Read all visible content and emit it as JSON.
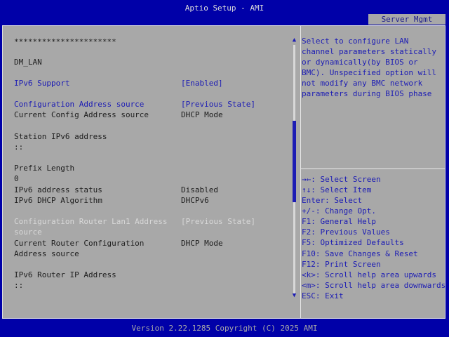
{
  "header": {
    "title": "Aptio Setup - AMI",
    "tab": "Server Mgmt"
  },
  "left": {
    "separator": "**********************",
    "section": "DM_LAN",
    "ipv6_support": {
      "label": "IPv6 Support",
      "value": "[Enabled]"
    },
    "config_addr_source": {
      "label": "Configuration Address source",
      "value": "[Previous State]"
    },
    "current_config_addr": {
      "label": "Current Config Address source",
      "value": "DHCP Mode"
    },
    "station_ipv6": {
      "label": "Station IPv6 address",
      "value": "::"
    },
    "prefix_length": {
      "label": "Prefix Length",
      "value": "0"
    },
    "ipv6_status": {
      "label": "IPv6 address status",
      "value": "Disabled"
    },
    "ipv6_dhcp": {
      "label": "IPv6 DHCP Algorithm",
      "value": "DHCPv6"
    },
    "config_router": {
      "label_line1": "Configuration Router Lan1 Address",
      "label_line2": "source",
      "value": "[Previous State]"
    },
    "current_router": {
      "label_line1": "Current Router Configuration",
      "label_line2": "Address source",
      "value": "DHCP Mode"
    },
    "router_ip": {
      "label": "IPv6 Router IP Address",
      "value": "::"
    }
  },
  "help": {
    "description": [
      "Select to configure LAN",
      "channel parameters statically",
      "or dynamically(by BIOS or",
      "BMC). Unspecified option will",
      "not modify any BMC network",
      "parameters during BIOS phase"
    ],
    "keys": [
      "→←: Select Screen",
      "↑↓: Select Item",
      "Enter: Select",
      "+/-: Change Opt.",
      "F1: General Help",
      "F2: Previous Values",
      "F5: Optimized Defaults",
      "F10: Save Changes & Reset",
      "F12: Print Screen",
      "<k>: Scroll help area upwards",
      "<m>: Scroll help area downwards",
      "ESC: Exit"
    ]
  },
  "scrollbar": {
    "up_icon": "▲",
    "down_icon": "▼"
  },
  "footer": {
    "version": "Version 2.22.1285 Copyright (C) 2025 AMI"
  }
}
